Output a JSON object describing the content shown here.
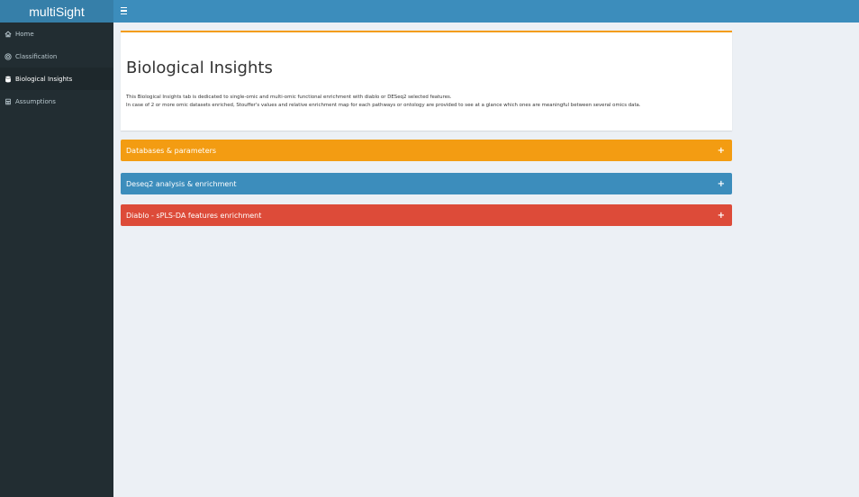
{
  "header": {
    "logo_text": "multiSight",
    "toggle_icon": "hamburger-icon"
  },
  "sidebar": {
    "items": [
      {
        "label": "Home",
        "icon": "home-icon",
        "active": false
      },
      {
        "label": "Classification",
        "icon": "target-icon",
        "active": false
      },
      {
        "label": "Biological Insights",
        "icon": "database-icon",
        "active": true
      },
      {
        "label": "Assumptions",
        "icon": "calculator-icon",
        "active": false
      }
    ]
  },
  "main": {
    "title": "Biological Insights",
    "description_line1": "This Biological Insights tab is dedicated to single-omic and multi-omic functional enrichment with diablo or DESeq2 selected features.",
    "description_line2": "In case of 2 or more omic datasets enriched, Stouffer's values and relative enrichment map for each pathways or ontology are provided to see at a glance which ones are meaningful between several omics data.",
    "panels": [
      {
        "label": "Databases & parameters",
        "expand_icon": "+",
        "color": "#f39c12"
      },
      {
        "label": "Deseq2 analysis & enrichment",
        "expand_icon": "+",
        "color": "#3c8dbc"
      },
      {
        "label": "Diablo - sPLS-DA features enrichment",
        "expand_icon": "+",
        "color": "#dd4b39"
      }
    ]
  },
  "colors": {
    "header_bg": "#3c8dbc",
    "logo_bg": "#367fa9",
    "sidebar_bg": "#222d32",
    "sidebar_active_bg": "#1e282c",
    "content_bg": "#ecf0f5",
    "intro_border": "#f39c12"
  }
}
